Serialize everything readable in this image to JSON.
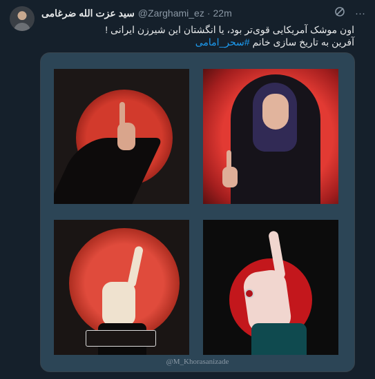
{
  "tweet": {
    "author": {
      "display_name": "سید عزت الله ضرغامی",
      "handle": "@Zarghami_ez",
      "separator": "·",
      "time": "22m"
    },
    "icons": {
      "grok": "grok-icon",
      "more": "more-options-icon"
    },
    "text": {
      "line1": "اون موشک آمریکایی قوی‌تر بود، یا انگشتان این شیرزن ایرانی !",
      "line2_prefix": "آفرین به تاریخ سازی خانم ",
      "hashtag": "#سحر_امامی"
    },
    "media": {
      "watermark": "@M_Khorasanizade",
      "panels": [
        "panel-hand-red-circle",
        "panel-woman-pointing",
        "panel-fist-finger",
        "panel-hand-ring"
      ]
    }
  }
}
